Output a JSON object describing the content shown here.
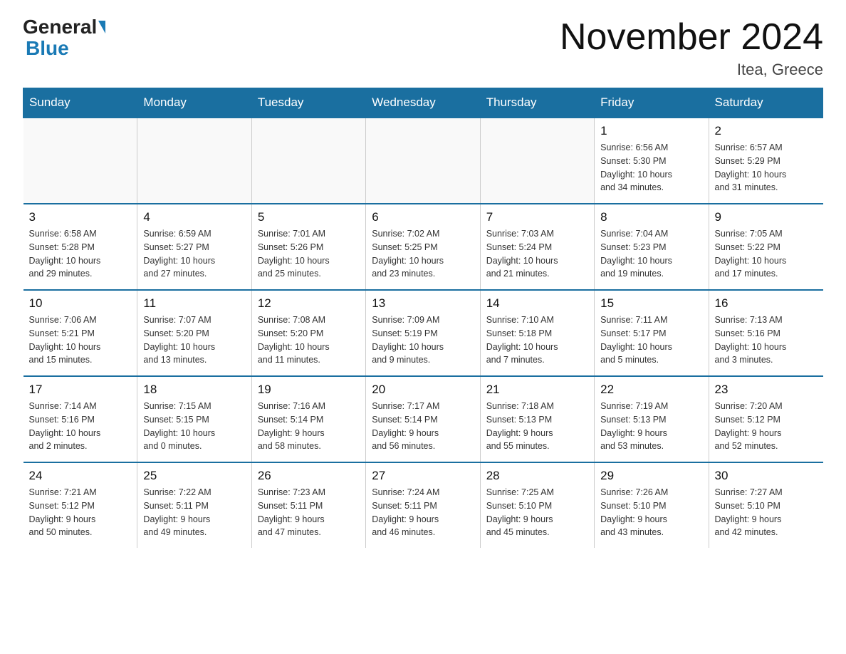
{
  "logo": {
    "general": "General",
    "blue": "Blue"
  },
  "title": "November 2024",
  "location": "Itea, Greece",
  "weekdays": [
    "Sunday",
    "Monday",
    "Tuesday",
    "Wednesday",
    "Thursday",
    "Friday",
    "Saturday"
  ],
  "weeks": [
    [
      {
        "day": "",
        "info": ""
      },
      {
        "day": "",
        "info": ""
      },
      {
        "day": "",
        "info": ""
      },
      {
        "day": "",
        "info": ""
      },
      {
        "day": "",
        "info": ""
      },
      {
        "day": "1",
        "info": "Sunrise: 6:56 AM\nSunset: 5:30 PM\nDaylight: 10 hours\nand 34 minutes."
      },
      {
        "day": "2",
        "info": "Sunrise: 6:57 AM\nSunset: 5:29 PM\nDaylight: 10 hours\nand 31 minutes."
      }
    ],
    [
      {
        "day": "3",
        "info": "Sunrise: 6:58 AM\nSunset: 5:28 PM\nDaylight: 10 hours\nand 29 minutes."
      },
      {
        "day": "4",
        "info": "Sunrise: 6:59 AM\nSunset: 5:27 PM\nDaylight: 10 hours\nand 27 minutes."
      },
      {
        "day": "5",
        "info": "Sunrise: 7:01 AM\nSunset: 5:26 PM\nDaylight: 10 hours\nand 25 minutes."
      },
      {
        "day": "6",
        "info": "Sunrise: 7:02 AM\nSunset: 5:25 PM\nDaylight: 10 hours\nand 23 minutes."
      },
      {
        "day": "7",
        "info": "Sunrise: 7:03 AM\nSunset: 5:24 PM\nDaylight: 10 hours\nand 21 minutes."
      },
      {
        "day": "8",
        "info": "Sunrise: 7:04 AM\nSunset: 5:23 PM\nDaylight: 10 hours\nand 19 minutes."
      },
      {
        "day": "9",
        "info": "Sunrise: 7:05 AM\nSunset: 5:22 PM\nDaylight: 10 hours\nand 17 minutes."
      }
    ],
    [
      {
        "day": "10",
        "info": "Sunrise: 7:06 AM\nSunset: 5:21 PM\nDaylight: 10 hours\nand 15 minutes."
      },
      {
        "day": "11",
        "info": "Sunrise: 7:07 AM\nSunset: 5:20 PM\nDaylight: 10 hours\nand 13 minutes."
      },
      {
        "day": "12",
        "info": "Sunrise: 7:08 AM\nSunset: 5:20 PM\nDaylight: 10 hours\nand 11 minutes."
      },
      {
        "day": "13",
        "info": "Sunrise: 7:09 AM\nSunset: 5:19 PM\nDaylight: 10 hours\nand 9 minutes."
      },
      {
        "day": "14",
        "info": "Sunrise: 7:10 AM\nSunset: 5:18 PM\nDaylight: 10 hours\nand 7 minutes."
      },
      {
        "day": "15",
        "info": "Sunrise: 7:11 AM\nSunset: 5:17 PM\nDaylight: 10 hours\nand 5 minutes."
      },
      {
        "day": "16",
        "info": "Sunrise: 7:13 AM\nSunset: 5:16 PM\nDaylight: 10 hours\nand 3 minutes."
      }
    ],
    [
      {
        "day": "17",
        "info": "Sunrise: 7:14 AM\nSunset: 5:16 PM\nDaylight: 10 hours\nand 2 minutes."
      },
      {
        "day": "18",
        "info": "Sunrise: 7:15 AM\nSunset: 5:15 PM\nDaylight: 10 hours\nand 0 minutes."
      },
      {
        "day": "19",
        "info": "Sunrise: 7:16 AM\nSunset: 5:14 PM\nDaylight: 9 hours\nand 58 minutes."
      },
      {
        "day": "20",
        "info": "Sunrise: 7:17 AM\nSunset: 5:14 PM\nDaylight: 9 hours\nand 56 minutes."
      },
      {
        "day": "21",
        "info": "Sunrise: 7:18 AM\nSunset: 5:13 PM\nDaylight: 9 hours\nand 55 minutes."
      },
      {
        "day": "22",
        "info": "Sunrise: 7:19 AM\nSunset: 5:13 PM\nDaylight: 9 hours\nand 53 minutes."
      },
      {
        "day": "23",
        "info": "Sunrise: 7:20 AM\nSunset: 5:12 PM\nDaylight: 9 hours\nand 52 minutes."
      }
    ],
    [
      {
        "day": "24",
        "info": "Sunrise: 7:21 AM\nSunset: 5:12 PM\nDaylight: 9 hours\nand 50 minutes."
      },
      {
        "day": "25",
        "info": "Sunrise: 7:22 AM\nSunset: 5:11 PM\nDaylight: 9 hours\nand 49 minutes."
      },
      {
        "day": "26",
        "info": "Sunrise: 7:23 AM\nSunset: 5:11 PM\nDaylight: 9 hours\nand 47 minutes."
      },
      {
        "day": "27",
        "info": "Sunrise: 7:24 AM\nSunset: 5:11 PM\nDaylight: 9 hours\nand 46 minutes."
      },
      {
        "day": "28",
        "info": "Sunrise: 7:25 AM\nSunset: 5:10 PM\nDaylight: 9 hours\nand 45 minutes."
      },
      {
        "day": "29",
        "info": "Sunrise: 7:26 AM\nSunset: 5:10 PM\nDaylight: 9 hours\nand 43 minutes."
      },
      {
        "day": "30",
        "info": "Sunrise: 7:27 AM\nSunset: 5:10 PM\nDaylight: 9 hours\nand 42 minutes."
      }
    ]
  ]
}
